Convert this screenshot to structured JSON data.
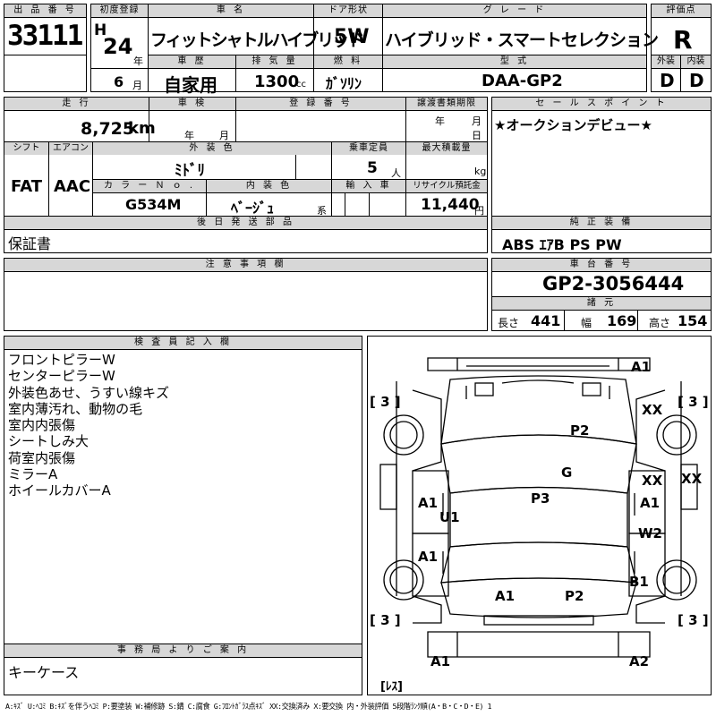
{
  "headers": {
    "lot": "出 品 番 号",
    "first_reg": "初度登録",
    "car_name": "車 名",
    "door_type": "ドア形状",
    "grade": "グ レ ー ド",
    "score": "評価点",
    "history": "車 歴",
    "displacement": "排 気 量",
    "fuel": "燃 料",
    "model_type": "型 式",
    "exterior": "外装",
    "interior": "内装",
    "mileage": "走 行",
    "inspection": "車 検",
    "registration": "登 録 番 号",
    "transfer_deadline": "譲渡書類期限",
    "sales_point": "セ ー ル ス ポ イ ン ト",
    "shift": "シフト",
    "aircon": "エアコン",
    "exterior_color": "外 装 色",
    "capacity": "乗車定員",
    "max_load": "最大積載量",
    "color_no": "カ ラ ー Ｎ ｏ .",
    "interior_color": "内 装 色",
    "import": "輸 入 車",
    "recycle": "リサイクル預託金",
    "later_parts": "後 日 発 送 部 品",
    "genuine": "純 正 装 備",
    "notes": "注 意 事 項 欄",
    "chassis": "車 台 番 号",
    "dimensions": "諸 元",
    "inspector": "検 査 員 記 入 欄",
    "office": "事 務 局 よ り ご 案 内"
  },
  "vehicle": {
    "lot_number": "33111",
    "era": "H",
    "year": "24",
    "year_unit": "年",
    "month": "6",
    "month_unit": "月",
    "car_name": "フィットシャトルハイブリッド",
    "door_type": "5W",
    "grade": "ハイブリッド・スマートセレクション",
    "score": "R",
    "exterior_grade": "D",
    "interior_grade": "D",
    "history": "自家用",
    "displacement": "1300",
    "displacement_unit": "cc",
    "fuel": "ｶﾞｿﾘﾝ",
    "model_type": "DAA-GP2",
    "mileage": "8,725",
    "mileage_unit": "km",
    "inspection_year_unit": "年",
    "inspection_month_unit": "月",
    "transfer_year_unit": "年",
    "transfer_month_unit": "月",
    "transfer_day_unit": "日",
    "sales_point": "★オークションデビュー★",
    "shift": "FAT",
    "aircon": "AAC",
    "exterior_color": "ﾐﾄﾞﾘ",
    "capacity": "5",
    "capacity_unit": "人",
    "max_load_unit": "kg",
    "color_no": "G534M",
    "interior_color": "ﾍﾞｰｼﾞｭ",
    "interior_color_suffix": "系",
    "recycle": "11,440",
    "recycle_unit": "円",
    "later_parts": "保証書",
    "genuine_equipment": "ABS ｴｱB PS PW",
    "chassis_number": "GP2-3056444",
    "length_label": "長さ",
    "length": "441",
    "width_label": "幅",
    "width": "169",
    "height_label": "高さ",
    "height": "154"
  },
  "inspector_notes": [
    "フロントピラーW",
    "センターピラーW",
    "外装色あせ、うすい線キズ",
    "室内薄汚れ、動物の毛",
    "室内内張傷",
    "シートしみ大",
    "荷室内張傷",
    "ミラーA",
    "ホイールカバーA"
  ],
  "office_note": "キーケース",
  "diagram": {
    "tire_fl": "[ 3 ]",
    "tire_fr": "[ 3 ]",
    "tire_rl": "[ 3 ]",
    "tire_rr": "[ 3 ]",
    "spare": "[ﾚｽ]",
    "marks": {
      "front_bumper_r": "A1",
      "fender_fr": "XX",
      "hood": "P2",
      "windshield": "G",
      "door_fr": "XX",
      "mirror_r": "XX",
      "door_fr_2": "A1",
      "roof": "P3",
      "door_fl": "A1",
      "pillar_l": "U1",
      "door_rr": "W2",
      "door_rl": "A1",
      "fender_rr": "B1",
      "trunk_l": "A1",
      "trunk_r": "P2",
      "rear_bumper_l": "A1",
      "rear_bumper_r": "A2"
    }
  },
  "legend": "A:ｷｽﾞ U:ﾍｺﾐ B:ｷｽﾞを伴うﾍｺﾐ P:要塗装 W:補修跡 S:錆 C:腐食 G:ﾌﾛﾝﾄｶﾞﾗｽ点ｷｽﾞ XX:交換済み X:要交換 内・外装評価 5段階ﾗﾝｸ順(A・B・C・D・E) 1"
}
